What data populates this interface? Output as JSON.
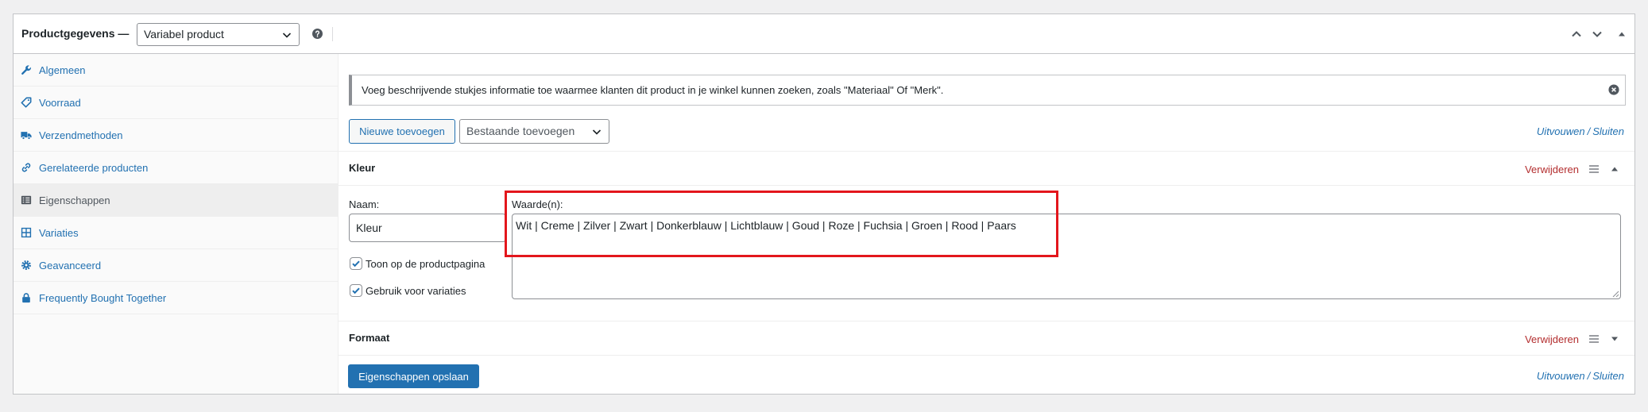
{
  "header": {
    "title": "Productgegevens —",
    "product_type": "Variabel product",
    "help_icon": "help-icon",
    "controls": [
      "chevron-up-icon",
      "chevron-down-icon",
      "triangle-up-icon"
    ]
  },
  "sidebar": {
    "items": [
      {
        "label": "Algemeen",
        "icon": "wrench-icon",
        "active": false
      },
      {
        "label": "Voorraad",
        "icon": "tag-icon",
        "active": false
      },
      {
        "label": "Verzendmethoden",
        "icon": "truck-icon",
        "active": false
      },
      {
        "label": "Gerelateerde producten",
        "icon": "link-icon",
        "active": false
      },
      {
        "label": "Eigenschappen",
        "icon": "list-icon",
        "active": true
      },
      {
        "label": "Variaties",
        "icon": "grid-icon",
        "active": false
      },
      {
        "label": "Geavanceerd",
        "icon": "gear-icon",
        "active": false
      },
      {
        "label": "Frequently Bought Together",
        "icon": "lock-icon",
        "active": false
      }
    ]
  },
  "notice": {
    "text": "Voeg beschrijvende stukjes informatie toe waarmee klanten dit product in je winkel kunnen zoeken, zoals \"Materiaal\" Of \"Merk\".",
    "close_icon": "close-circle-icon"
  },
  "toolbar": {
    "add_new_label": "Nieuwe toevoegen",
    "add_existing_placeholder": "Bestaande toevoegen",
    "expand_label": "Uitvouwen",
    "separator": "/",
    "close_label": "Sluiten"
  },
  "attributes": [
    {
      "name": "Kleur",
      "remove_label": "Verwijderen",
      "expanded": true,
      "name_label": "Naam:",
      "name_value": "Kleur",
      "values_label": "Waarde(n):",
      "values": "Wit | Creme | Zilver | Zwart | Donkerblauw | Lichtblauw | Goud | Roze | Fuchsia | Groen | Rood | Paars",
      "visible_label": "Toon op de productpagina",
      "visible_checked": true,
      "variation_label": "Gebruik voor variaties",
      "variation_checked": true
    },
    {
      "name": "Formaat",
      "remove_label": "Verwijderen",
      "expanded": false
    }
  ],
  "footer": {
    "save_label": "Eigenschappen opslaan",
    "expand_label": "Uitvouwen",
    "separator": "/",
    "close_label": "Sluiten"
  },
  "colors": {
    "link": "#2271b1",
    "danger": "#b32d2e",
    "primary_button": "#2271b1",
    "active_tab_bg": "#eeeeee",
    "highlight_border": "#e3161c"
  }
}
